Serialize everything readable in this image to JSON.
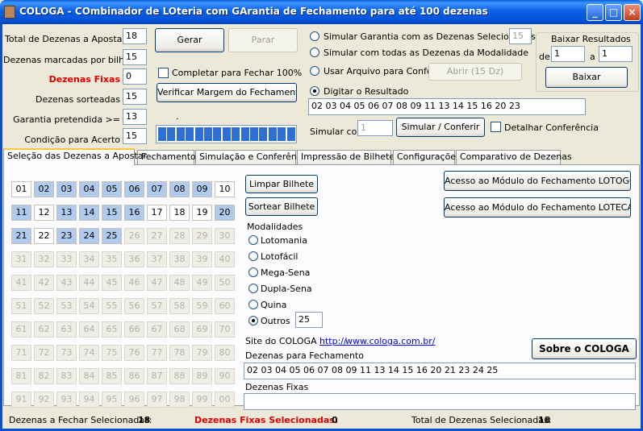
{
  "window": {
    "title": "COLOGA - COmbinador de LOteria com GArantia de Fechamento para até 100 dezenas",
    "controls": [
      "_",
      "□",
      "×"
    ]
  },
  "settings": {
    "total_label": "Total de Dezenas a Apostar",
    "total_value": "18",
    "per_bet_label": "Dezenas marcadas por bilhete",
    "per_bet_value": "15",
    "fixed_label": "Dezenas Fixas",
    "fixed_value": "0",
    "drawn_label": "Dezenas sorteadas",
    "drawn_value": "15",
    "guarantee_label": "Garantia pretendida >=",
    "guarantee_value": "13",
    "condition_label": "Condição para Acerto",
    "condition_value": "15"
  },
  "actions": {
    "generate": "Gerar",
    "stop": "Parar",
    "complete_check": "Completar para Fechar 100%",
    "check_margin": "Verificar Margem do Fechamento"
  },
  "progress": {
    "blocks": 15,
    "filled": 15,
    "dot": "."
  },
  "simulation": {
    "opt_selected": "Simular Garantia com as Dezenas Selecionadas",
    "opt_selected_value": "15",
    "opt_all": "Simular com todas as Dezenas da Modalidade",
    "opt_file": "Usar Arquivo para Conferir",
    "open_button": "Abrir (15 Dz)",
    "opt_type": "Digitar o Resultado",
    "result_value": "02 03 04 05 06 07 08 09 11 13 14 15 16 20 23",
    "simulate_with_label": "Simular com",
    "simulate_with_value": "1",
    "simulate_button": "Simular / Conferir",
    "detail_check": "Detalhar Conferência"
  },
  "download": {
    "title": "Baixar Resultados",
    "from_label": "de",
    "from_value": "1",
    "to_label": "a",
    "to_value": "1",
    "button": "Baixar"
  },
  "tabs": [
    "Seleção das Dezenas a Apostar",
    "Fechamento",
    "Simulação e Conferência",
    "Impressão de Bilhetes",
    "Configurações",
    "Comparativo de Dezenas"
  ],
  "grid": {
    "numbers": [
      "01",
      "02",
      "03",
      "04",
      "05",
      "06",
      "07",
      "08",
      "09",
      "10",
      "11",
      "12",
      "13",
      "14",
      "15",
      "16",
      "17",
      "18",
      "19",
      "20",
      "21",
      "22",
      "23",
      "24",
      "25",
      "26",
      "27",
      "28",
      "29",
      "30",
      "31",
      "32",
      "33",
      "34",
      "35",
      "36",
      "37",
      "38",
      "39",
      "40",
      "41",
      "42",
      "43",
      "44",
      "45",
      "46",
      "47",
      "48",
      "49",
      "50",
      "51",
      "52",
      "53",
      "54",
      "55",
      "56",
      "57",
      "58",
      "59",
      "60",
      "61",
      "62",
      "63",
      "64",
      "65",
      "66",
      "67",
      "68",
      "69",
      "70",
      "71",
      "72",
      "73",
      "74",
      "75",
      "76",
      "77",
      "78",
      "79",
      "80",
      "81",
      "82",
      "83",
      "84",
      "85",
      "86",
      "87",
      "88",
      "89",
      "90",
      "91",
      "92",
      "93",
      "94",
      "95",
      "96",
      "97",
      "98",
      "99",
      "00"
    ],
    "selected": [
      "02",
      "03",
      "04",
      "05",
      "06",
      "07",
      "08",
      "09",
      "11",
      "13",
      "14",
      "15",
      "16",
      "20",
      "21",
      "23",
      "24",
      "25"
    ],
    "enabled_max": 25
  },
  "panel": {
    "clear_button": "Limpar Bilhete",
    "draw_button": "Sortear Bilhete",
    "modalities_label": "Modalidades",
    "modalities": [
      "Lotomania",
      "Lotofácil",
      "Mega-Sena",
      "Dupla-Sena",
      "Quina",
      "Outros"
    ],
    "selected_modality": "Outros",
    "others_value": "25",
    "lotogol_button": "Acesso ao Módulo do Fechamento LOTOGOL",
    "loteca_button": "Acesso ao Módulo do Fechamento LOTECA",
    "site_label": "Site do COLOGA",
    "site_link_prefix": "http://",
    "site_link": "www.cologa.com.br/",
    "about_button": "Sobre o COLOGA",
    "closing_label": "Dezenas para Fechamento",
    "closing_value": "02 03 04 05 06 07 08 09 11 13 14 15 16 20 21 23 24 25",
    "fixed_label": "Dezenas Fixas",
    "fixed_value": ""
  },
  "status": {
    "to_close_label": "Dezenas a Fechar Selecionadas:",
    "to_close_value": "18",
    "fixed_label": "Dezenas Fixas Selecionadas:",
    "fixed_value": "0",
    "total_label": "Total de Dezenas Selecionadas:",
    "total_value": "18"
  },
  "colors": {
    "selected_cell": "#b0cbee",
    "fixed_red": "#e00000",
    "title_blue": "#0b61e3"
  }
}
